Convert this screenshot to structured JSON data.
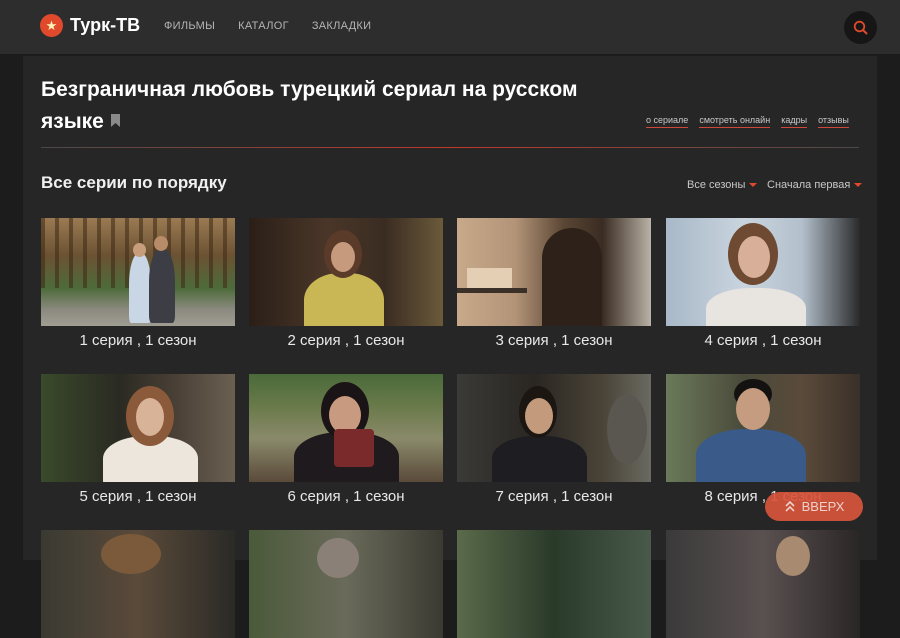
{
  "header": {
    "logo_icon": "star-icon",
    "logo_text": "Турк-ТВ",
    "nav": [
      "ФИЛЬМЫ",
      "КАТАЛОГ",
      "ЗАКЛАДКИ"
    ],
    "search_icon": "search-icon",
    "accent": "#e0492b"
  },
  "main": {
    "title": "Безграничная любовь турецкий сериал на русском языке",
    "tabs": [
      "о сериале",
      "смотреть онлайн",
      "кадры",
      "отзывы"
    ],
    "section_title": "Все серии по порядку",
    "season_filter": "Все сезоны",
    "order_filter": "Сначала первая"
  },
  "episodes": [
    {
      "label": "1 серия , 1 сезон",
      "icon": "episode-thumbnail"
    },
    {
      "label": "2 серия , 1 сезон",
      "icon": "episode-thumbnail"
    },
    {
      "label": "3 серия , 1 сезон",
      "icon": "episode-thumbnail"
    },
    {
      "label": "4 серия , 1 сезон",
      "icon": "episode-thumbnail"
    },
    {
      "label": "5 серия , 1 сезон",
      "icon": "episode-thumbnail"
    },
    {
      "label": "6 серия , 1 сезон",
      "icon": "episode-thumbnail"
    },
    {
      "label": "7 серия , 1 сезон",
      "icon": "episode-thumbnail"
    },
    {
      "label": "8 серия , 1 сезон",
      "icon": "episode-thumbnail"
    }
  ],
  "scroll_top": {
    "label": "ВВЕРХ",
    "icon": "double-chevron-up-icon"
  }
}
